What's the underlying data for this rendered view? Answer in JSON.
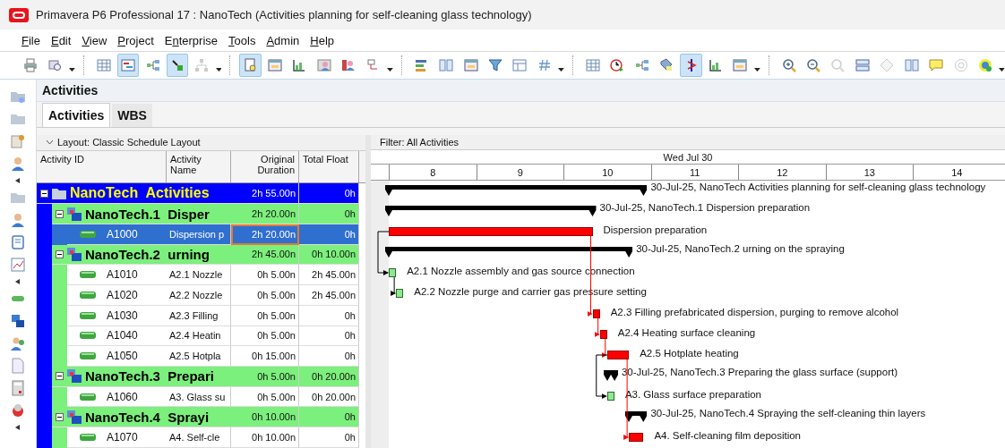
{
  "window": {
    "title": "Primavera P6 Professional 17 : NanoTech (Activities planning for self-cleaning glass technology)"
  },
  "menu": [
    {
      "key": "F",
      "rest": "ile"
    },
    {
      "key": "E",
      "rest": "dit"
    },
    {
      "key": "V",
      "rest": "iew"
    },
    {
      "key": "P",
      "rest": "roject"
    },
    {
      "key": "n",
      "rest": "terprise",
      "lead": "E"
    },
    {
      "key": "T",
      "rest": "ools"
    },
    {
      "key": "A",
      "rest": "dmin"
    },
    {
      "key": "H",
      "rest": "elp"
    }
  ],
  "toolbar": [
    {
      "buttons": [
        {
          "kind": "print",
          "pressed": false
        },
        {
          "kind": "preview",
          "pressed": false
        }
      ]
    },
    {
      "buttons": [
        {
          "kind": "table",
          "pressed": false
        },
        {
          "kind": "gantt",
          "pressed": true
        },
        {
          "kind": "network",
          "pressed": false
        },
        {
          "kind": "trace",
          "pressed": true
        },
        {
          "kind": "hierarchy",
          "pressed": false
        }
      ]
    },
    {
      "buttons": [
        {
          "kind": "details",
          "pressed": true
        },
        {
          "kind": "window",
          "pressed": false
        },
        {
          "kind": "chart",
          "pressed": false
        },
        {
          "kind": "person",
          "pressed": false
        },
        {
          "kind": "people",
          "pressed": false
        },
        {
          "kind": "link",
          "pressed": false
        }
      ]
    },
    {
      "buttons": [
        {
          "kind": "bars",
          "pressed": false
        },
        {
          "kind": "columns",
          "pressed": false
        },
        {
          "kind": "window",
          "pressed": false
        },
        {
          "kind": "filter",
          "pressed": false
        },
        {
          "kind": "layout",
          "pressed": false
        },
        {
          "kind": "hash",
          "pressed": false
        }
      ]
    },
    {
      "buttons": [
        {
          "kind": "table",
          "pressed": false
        },
        {
          "kind": "clock",
          "pressed": false
        },
        {
          "kind": "network",
          "pressed": false
        },
        {
          "kind": "tag",
          "pressed": false
        },
        {
          "kind": "progress-line",
          "pressed": true
        },
        {
          "kind": "chart",
          "pressed": false
        },
        {
          "kind": "window",
          "pressed": false
        }
      ]
    },
    {
      "buttons": [
        {
          "kind": "zoom-in",
          "pressed": false
        },
        {
          "kind": "zoom-out",
          "pressed": false
        },
        {
          "kind": "zoom",
          "pressed": false
        },
        {
          "kind": "rows",
          "pressed": false
        },
        {
          "kind": "diamond",
          "pressed": false
        },
        {
          "kind": "columns",
          "pressed": false
        },
        {
          "kind": "comment",
          "pressed": false
        },
        {
          "kind": "help",
          "pressed": false
        },
        {
          "kind": "globe-help",
          "pressed": false
        }
      ]
    }
  ],
  "panel": {
    "title": "Activities"
  },
  "tabs": [
    {
      "label": "Activities",
      "selected": true
    },
    {
      "label": "WBS",
      "selected": false
    }
  ],
  "layout_bar": {
    "label": "Layout: Classic Schedule Layout"
  },
  "columns": [
    {
      "label": "Activity ID"
    },
    {
      "label": "Activity Name"
    },
    {
      "label": "Original Duration"
    },
    {
      "label": "Total Float"
    }
  ],
  "filter_bar": {
    "label": "Filter: All Activities"
  },
  "timescale": {
    "day": "Wed Jul 30",
    "hours": [
      "8",
      "9",
      "10",
      "11",
      "12",
      "13",
      "14"
    ]
  },
  "rows": [
    {
      "id": "NanoTech  Activities",
      "duration": "2h 55.00n",
      "float": "0h",
      "selected": false,
      "expanded": true,
      "bar": {
        "kind": "summary",
        "label": "30-Jul-25, NanoTech  Activities planning for self-cleaning glass technology"
      },
      "children": [
        {
          "id": "NanoTech.1  Disper",
          "duration": "2h 20.00n",
          "float": "0h",
          "selected": false,
          "expanded": true,
          "bar": {
            "kind": "summary",
            "label": "30-Jul-25, NanoTech.1  Dispersion preparation"
          },
          "children": [
            {
              "id": "A1000",
              "name": "Dispersion p",
              "duration": "2h 20.00n",
              "float": "0h",
              "selected": true,
              "bar": {
                "kind": "critical",
                "label": "Dispersion preparation"
              }
            }
          ]
        },
        {
          "id": "NanoTech.2  urning",
          "duration": "2h 45.00n",
          "float": "0h 10.00n",
          "selected": false,
          "expanded": true,
          "bar": {
            "kind": "summary",
            "label": "30-Jul-25, NanoTech.2  urning on the spraying"
          },
          "children": [
            {
              "id": "A1010",
              "name": "A2.1 Nozzle",
              "duration": "0h 5.00n",
              "float": "2h 45.00n",
              "selected": false,
              "bar": {
                "kind": "normal",
                "label": "A2.1 Nozzle assembly and gas source connection"
              }
            },
            {
              "id": "A1020",
              "name": "A2.2 Nozzle",
              "duration": "0h 5.00n",
              "float": "2h 45.00n",
              "selected": false,
              "bar": {
                "kind": "normal",
                "label": "A2.2 Nozzle purge and carrier gas pressure setting"
              }
            },
            {
              "id": "A1030",
              "name": "A2.3 Filling",
              "duration": "0h 5.00n",
              "float": "0h",
              "selected": false,
              "bar": {
                "kind": "critical",
                "label": "A2.3 Filling prefabricated dispersion, purging to remove alcohol"
              }
            },
            {
              "id": "A1040",
              "name": "A2.4 Heatin",
              "duration": "0h 5.00n",
              "float": "0h",
              "selected": false,
              "bar": {
                "kind": "critical",
                "label": "A2.4 Heating surface cleaning"
              }
            },
            {
              "id": "A1050",
              "name": "A2.5 Hotpla",
              "duration": "0h 15.00n",
              "float": "0h",
              "selected": false,
              "bar": {
                "kind": "critical",
                "label": "A2.5 Hotplate heating"
              }
            }
          ]
        },
        {
          "id": "NanoTech.3  Prepari",
          "duration": "0h 5.00n",
          "float": "0h 20.00n",
          "selected": false,
          "expanded": true,
          "bar": {
            "kind": "summary",
            "label": "30-Jul-25, NanoTech.3  Preparing the glass surface (support)"
          },
          "children": [
            {
              "id": "A1060",
              "name": "A3. Glass su",
              "duration": "0h 5.00n",
              "float": "0h 20.00n",
              "selected": false,
              "bar": {
                "kind": "normal",
                "label": "A3. Glass surface preparation"
              }
            }
          ]
        },
        {
          "id": "NanoTech.4  Sprayi",
          "duration": "0h 10.00n",
          "float": "0h",
          "selected": false,
          "expanded": true,
          "bar": {
            "kind": "summary",
            "label": "30-Jul-25, NanoTech.4  Spraying the self-cleaning thin layers"
          },
          "children": [
            {
              "id": "A1070",
              "name": "A4. Self-cle",
              "duration": "0h 10.00n",
              "float": "0h",
              "selected": false,
              "bar": {
                "kind": "critical",
                "label": "A4. Self-cleaning film deposition"
              }
            }
          ]
        }
      ]
    }
  ]
}
